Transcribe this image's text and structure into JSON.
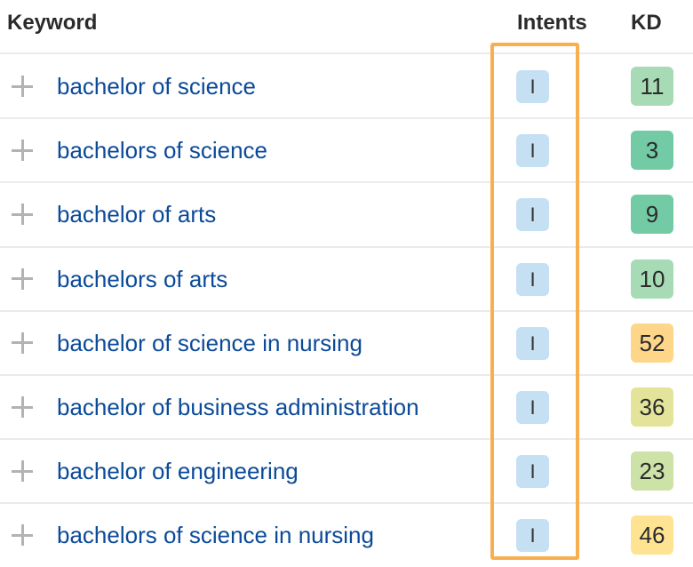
{
  "table": {
    "headers": {
      "keyword": "Keyword",
      "intents": "Intents",
      "kd": "KD"
    },
    "rows": [
      {
        "keyword": "bachelor of science",
        "intent": "I",
        "kd": "11",
        "kd_color": "#a7dbb6"
      },
      {
        "keyword": "bachelors of science",
        "intent": "I",
        "kd": "3",
        "kd_color": "#72cba4"
      },
      {
        "keyword": "bachelor of arts",
        "intent": "I",
        "kd": "9",
        "kd_color": "#72cba4"
      },
      {
        "keyword": "bachelors of arts",
        "intent": "I",
        "kd": "10",
        "kd_color": "#a7dbb6"
      },
      {
        "keyword": "bachelor of science in nursing",
        "intent": "I",
        "kd": "52",
        "kd_color": "#fdd68a"
      },
      {
        "keyword": "bachelor of business administration",
        "intent": "I",
        "kd": "36",
        "kd_color": "#e3e49a"
      },
      {
        "keyword": "bachelor of engineering",
        "intent": "I",
        "kd": "23",
        "kd_color": "#cde2a6"
      },
      {
        "keyword": "bachelors of science in nursing",
        "intent": "I",
        "kd": "46",
        "kd_color": "#fde392"
      }
    ]
  },
  "colors": {
    "keyword_link": "#0b4a99",
    "intent_badge": "#c5dff3",
    "highlight_border": "#f9ae4f",
    "add_icon": "#b3b3b3"
  }
}
